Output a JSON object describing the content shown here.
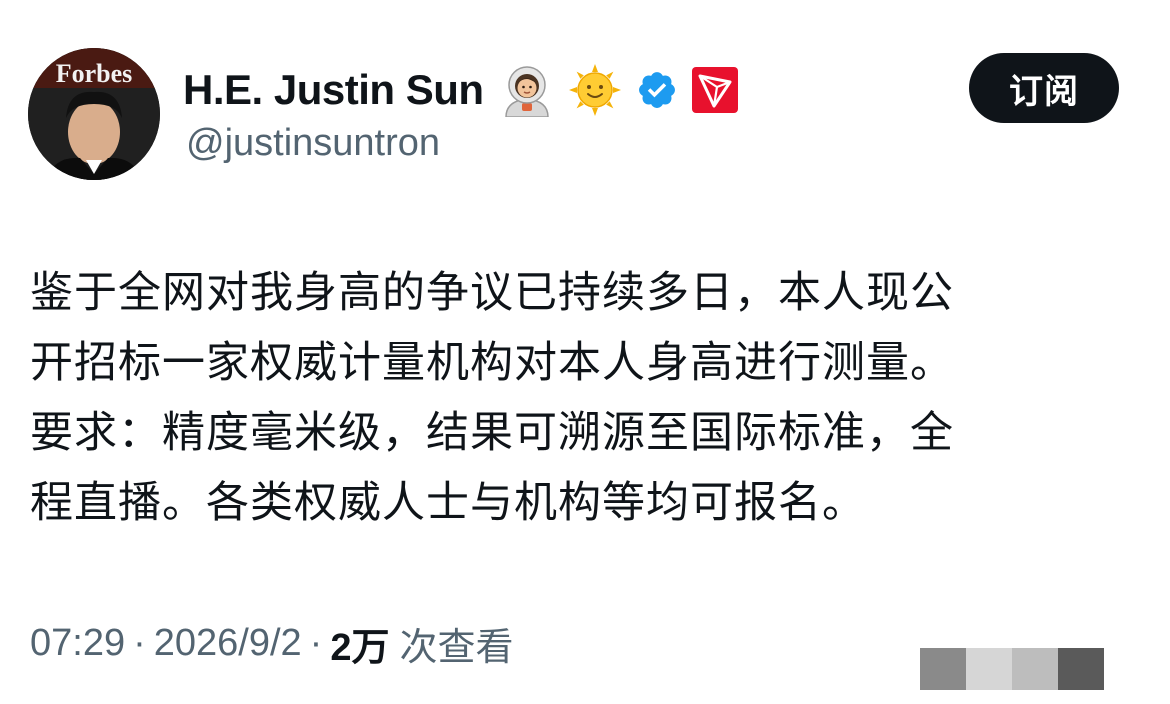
{
  "user": {
    "display_name": "H.E. Justin Sun",
    "handle": "@justinsuntron",
    "verified": true,
    "name_icons": [
      "astronaut-emoji",
      "sun-face-emoji",
      "verified-badge-icon",
      "tron-logo-icon"
    ],
    "avatar_magazine_text": "Forbes"
  },
  "subscribe_button": {
    "label": "订阅"
  },
  "tweet": {
    "lines": [
      "鉴于全网对我身高的争议已持续多日，本人现公",
      "开招标一家权威计量机构对本人身高进行测量。",
      "要求：精度毫米级，结果可溯源至国际标准，全",
      "程直播。各类权威人士与机构等均可报名。"
    ]
  },
  "meta": {
    "time": "07:29",
    "separator": "·",
    "date": "2026/9/2",
    "views_count": "2万",
    "views_label": "次查看"
  },
  "colors": {
    "text_primary": "#0f1419",
    "text_secondary": "#536471",
    "verified_blue": "#1d9bf0",
    "tron_red": "#e8112d",
    "button_bg": "#0f1419"
  }
}
